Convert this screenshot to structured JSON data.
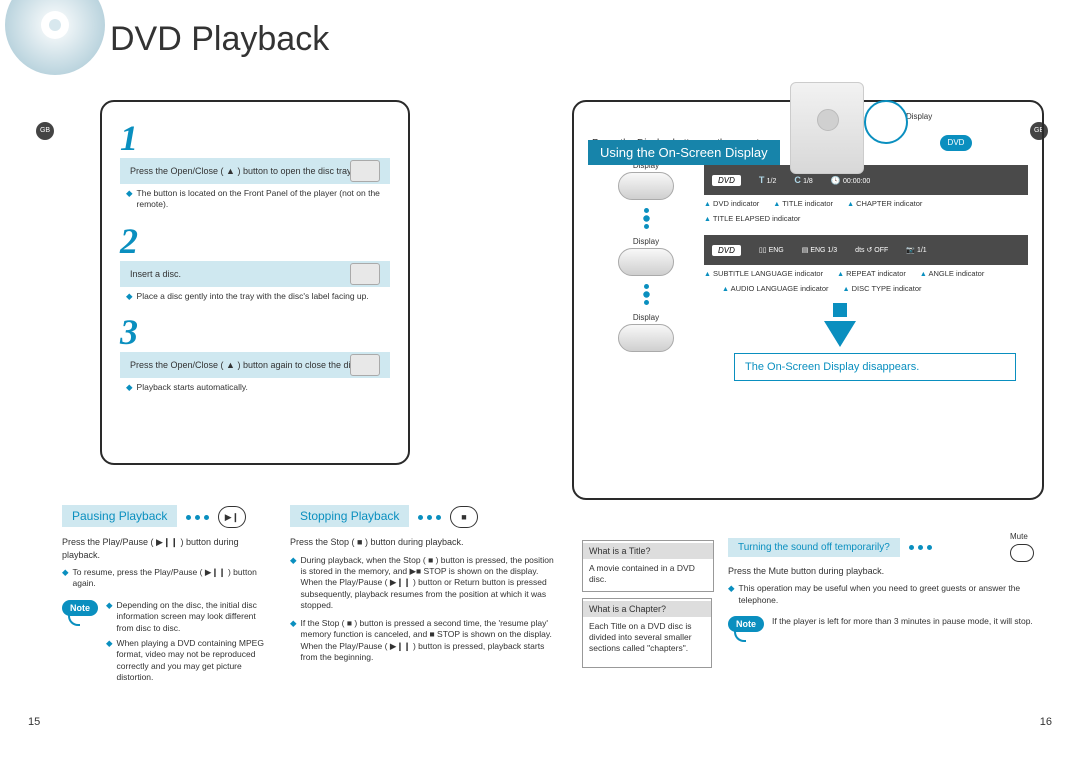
{
  "page_title": "DVD Playback",
  "gb_label": "GB",
  "dvd_badge": "DVD",
  "display_label": "Display",
  "steps": [
    {
      "num": "1",
      "box": "Press the Open/Close ( ▲ ) button to open the disc tray.",
      "bullet": "The button is located on the Front Panel of the player (not on the remote)."
    },
    {
      "num": "2",
      "box": "Insert a disc.",
      "bullet": "Place a disc gently into the tray with the disc's label facing up."
    },
    {
      "num": "3",
      "box": "Press the Open/Close ( ▲ ) button again to close the disc tray.",
      "bullet": "Playback starts automatically."
    }
  ],
  "osd": {
    "header": "Using the On-Screen Display",
    "sub": "Press the Display button on the remote.",
    "display_label": "Display",
    "bar1": {
      "t_label": "T",
      "t_val": "1/2",
      "c_label": "C",
      "c_val": "1/8",
      "time": "00:00:00"
    },
    "ind1": {
      "dvd": "DVD indicator",
      "title": "TITLE indicator",
      "chapter": "CHAPTER indicator",
      "elapsed": "TITLE ELAPSED indicator"
    },
    "bar2": {
      "eng": "ENG",
      "eng_track": "ENG 1/3",
      "off": "OFF",
      "angle": "1/1"
    },
    "ind2": {
      "subtitle": "SUBTITLE LANGUAGE indicator",
      "audio": "AUDIO LANGUAGE indicator",
      "disc": "DISC TYPE indicator",
      "repeat": "REPEAT indicator",
      "angle": "ANGLE indicator"
    },
    "disappear": "The On-Screen Display disappears."
  },
  "pause": {
    "head": "Pausing Playback",
    "p1": "Press the Play/Pause ( ▶❙❙ ) button during playback.",
    "b1": "To resume, press the Play/Pause ( ▶❙❙ ) button again.",
    "note_label": "Note",
    "n1": "Depending on the disc, the initial disc information screen may look different from disc to disc.",
    "n2": "When playing a DVD containing MPEG format, video may not be reproduced correctly and you may get picture distortion."
  },
  "stop": {
    "head": "Stopping Playback",
    "p1": "Press the Stop ( ■ ) button during playback.",
    "b1": "During playback, when the Stop ( ■ ) button is pressed, the position is stored in the memory, and ▶■ STOP is shown on the display. When the Play/Pause ( ▶❙❙ ) button or Return button is pressed subsequently, playback resumes from the position at which it was stopped.",
    "b2": "If the Stop ( ■ ) button is pressed a second time, the 'resume play' memory function is canceled, and ■ STOP is shown on the display. When the Play/Pause ( ▶❙❙ ) button is pressed, playback starts from the beginning."
  },
  "defs": {
    "title_q": "What is a Title?",
    "title_a": "A movie contained in a DVD disc.",
    "chap_q": "What is a Chapter?",
    "chap_a": "Each Title on a DVD disc is divided into several smaller sections called \"chapters\"."
  },
  "mute": {
    "head": "Turning the sound off temporarily?",
    "icon_label": "Mute",
    "p1": "Press the Mute button during playback.",
    "b1": "This operation may be useful when you need to greet guests or answer the telephone.",
    "note_label": "Note",
    "n1": "If the player is left for more than 3 minutes in pause mode, it will stop."
  },
  "page_left": "15",
  "page_right": "16"
}
